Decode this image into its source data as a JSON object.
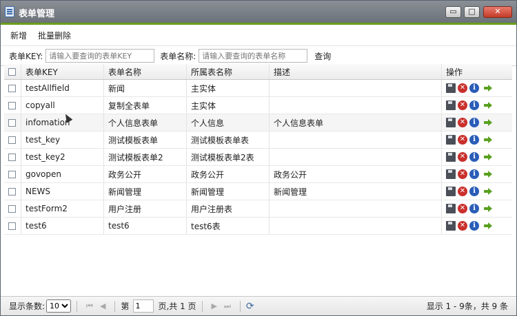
{
  "window": {
    "title": "表单管理"
  },
  "toolbar": {
    "add": "新增",
    "batch_delete": "批量删除"
  },
  "search": {
    "key_label": "表单KEY:",
    "key_placeholder": "请输入要查询的表单KEY",
    "name_label": "表单名称:",
    "name_placeholder": "请输入要查询的表单名称",
    "query": "查询"
  },
  "grid": {
    "columns": [
      "表单KEY",
      "表单名称",
      "所属表名称",
      "描述",
      "操作"
    ],
    "rows": [
      [
        "testAllfield",
        "新闻",
        "主实体",
        ""
      ],
      [
        "copyall",
        "复制全表单",
        "主实体",
        ""
      ],
      [
        "infomation",
        "个人信息表单",
        "个人信息",
        "个人信息表单"
      ],
      [
        "test_key",
        "测试模板表单",
        "测试模板表单表",
        ""
      ],
      [
        "test_key2",
        "测试模板表单2",
        "测试模板表单2表",
        ""
      ],
      [
        "govopen",
        "政务公开",
        "政务公开",
        "政务公开"
      ],
      [
        "NEWS",
        "新闻管理",
        "新闻管理",
        "新闻管理"
      ],
      [
        "testForm2",
        "用户注册",
        "用户注册表",
        ""
      ],
      [
        "test6",
        "test6",
        "test6表",
        ""
      ]
    ]
  },
  "pager": {
    "page_size_label": "显示条数:",
    "page_size": "10",
    "page_label": "第",
    "page": "1",
    "total_pages": "页,共 1 页",
    "summary": "显示 1 - 9条，共 9 条"
  }
}
